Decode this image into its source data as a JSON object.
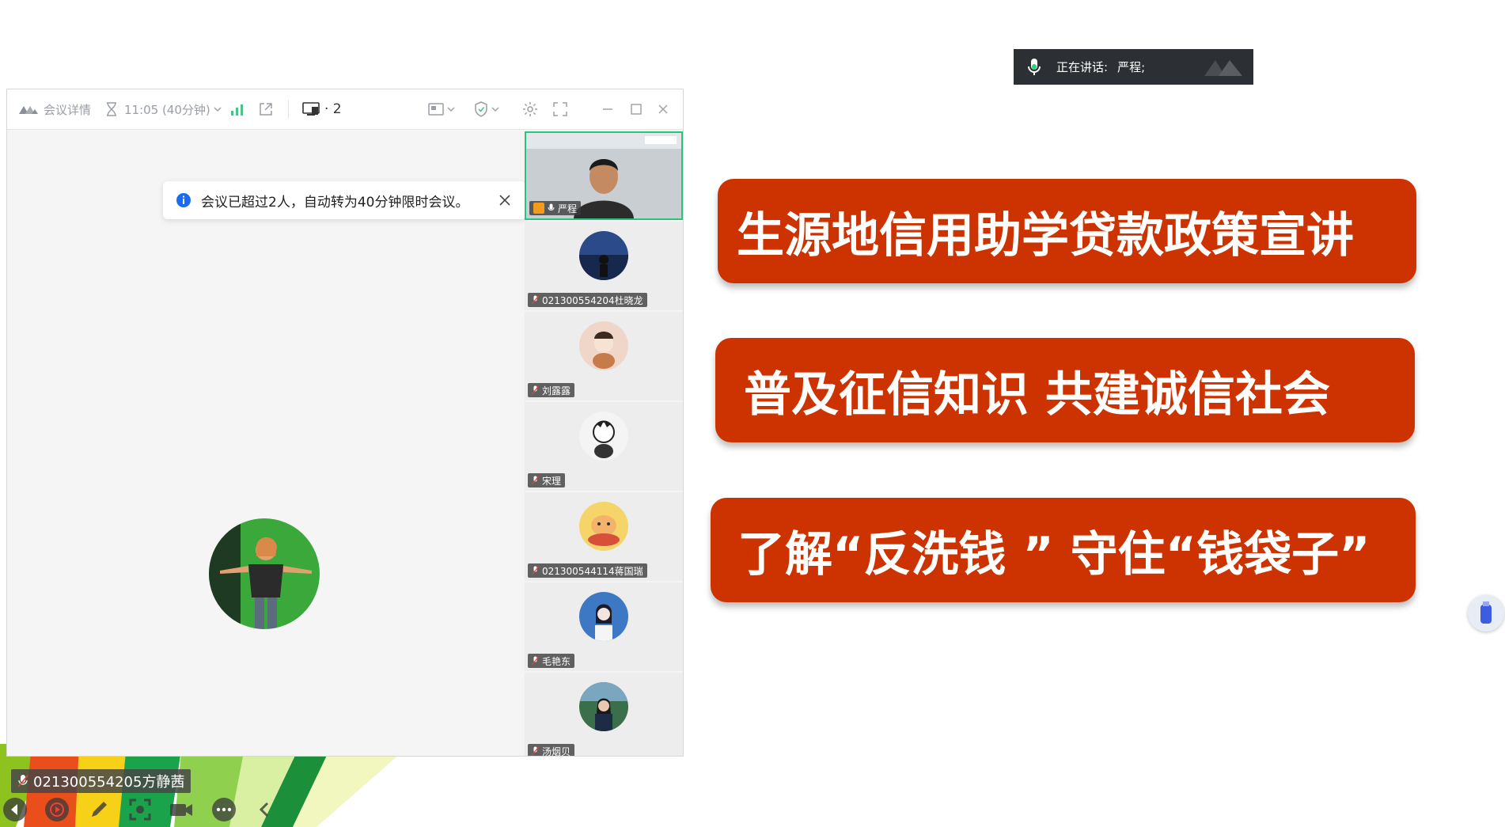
{
  "speaking": {
    "label": "正在讲话:",
    "name": "严程;"
  },
  "meeting": {
    "toolbar": {
      "details_label": "会议详情",
      "timer_label": "11:05 (40分钟)",
      "share_count": "· 2"
    },
    "notice": {
      "text": "会议已超过2人，自动转为40分钟限时会议。"
    },
    "main_participant": {
      "name": "021300554205方静茜"
    },
    "participants": [
      {
        "name": "严程",
        "is_speaking": true,
        "is_host": true
      },
      {
        "name": "021300554204杜晓龙"
      },
      {
        "name": "刘露露"
      },
      {
        "name": "宋理"
      },
      {
        "name": "021300544114蒋国瑞"
      },
      {
        "name": "毛艳东"
      },
      {
        "name": "汤烟贝"
      }
    ]
  },
  "slide": {
    "banner_1": "生源地信用助学贷款政策宣讲",
    "banner_2": "普及征信知识  共建诚信社会",
    "banner_3": "了解“反洗钱 ” 守住“钱袋子”",
    "banner_color": "#cc3300"
  },
  "colors": {
    "active_border": "#29c37f",
    "host_badge": "#f29b1d"
  }
}
